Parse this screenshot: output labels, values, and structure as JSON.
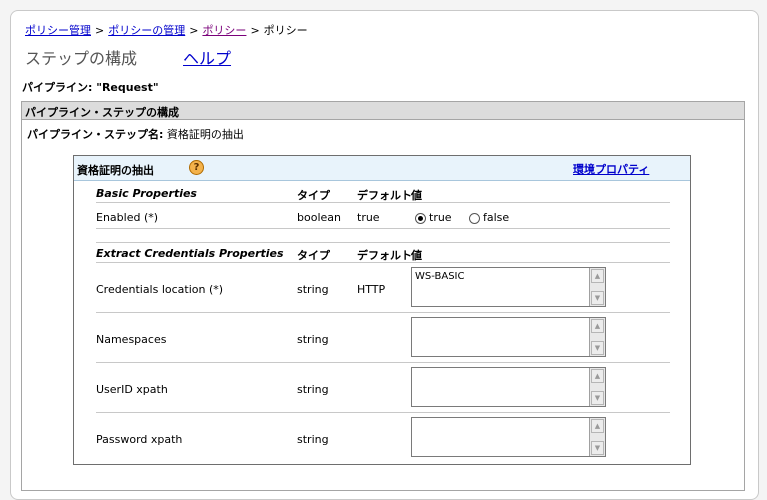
{
  "breadcrumb": {
    "items": [
      "ポリシー管理",
      "ポリシーの管理",
      "ポリシー"
    ],
    "current": "ポリシー",
    "separator": ">"
  },
  "page": {
    "title": "ステップの構成",
    "help_link": "ヘルプ"
  },
  "pipeline": {
    "label": "パイプライン: \"Request\""
  },
  "section": {
    "header": "パイプライン・ステップの構成",
    "step_name_label": "パイプライン・ステップ名:",
    "step_name_value": "資格証明の抽出"
  },
  "panel": {
    "title": "資格証明の抽出",
    "help_icon": "?",
    "env_link": "環境プロパティ"
  },
  "basic": {
    "heading": "Basic Properties",
    "col_type": "タイプ",
    "col_default": "デフォルト",
    "col_value": "値",
    "rows": [
      {
        "name": "Enabled (*)",
        "type": "boolean",
        "default": "true",
        "opt_true": "true",
        "opt_false": "false",
        "selected": "true"
      }
    ]
  },
  "extract": {
    "heading": "Extract Credentials Properties",
    "col_type": "タイプ",
    "col_default": "デフォルト",
    "col_value": "値",
    "rows": [
      {
        "name": "Credentials location (*)",
        "type": "string",
        "default": "HTTP",
        "value": "WS-BASIC"
      },
      {
        "name": "Namespaces",
        "type": "string",
        "default": "",
        "value": ""
      },
      {
        "name": "UserID xpath",
        "type": "string",
        "default": "",
        "value": ""
      },
      {
        "name": "Password xpath",
        "type": "string",
        "default": "",
        "value": ""
      }
    ]
  },
  "icons": {
    "scroll_up": "scroll-up-arrow-icon",
    "scroll_down": "scroll-down-arrow-icon",
    "help": "help-question-icon"
  },
  "colors": {
    "link": "#0000cc",
    "visited_link": "#7a007a",
    "section_header_bg": "#dcdcdc",
    "panel_header_bg": "#e8f3fb",
    "help_icon": "#f4b24b"
  }
}
